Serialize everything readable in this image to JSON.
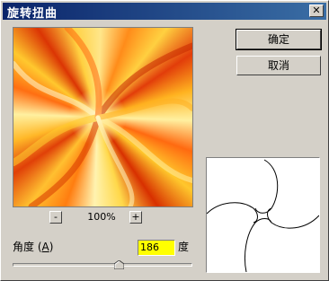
{
  "window": {
    "title": "旋转扭曲",
    "close_label": "✕"
  },
  "buttons": {
    "ok": "确定",
    "cancel": "取消"
  },
  "zoom": {
    "minus": "-",
    "plus": "+",
    "level": "100%"
  },
  "angle": {
    "label": "角度",
    "mnemonic": "A",
    "value": "186",
    "unit": "度",
    "slider_min": -999,
    "slider_max": 999,
    "slider_value": 186
  },
  "colors": {
    "titlebar": "#0a246a",
    "input_highlight": "#ffff00",
    "dialog_bg": "#d4d0c8"
  },
  "icons": {
    "close": "close-icon",
    "thumb": "slider-thumb-icon"
  }
}
